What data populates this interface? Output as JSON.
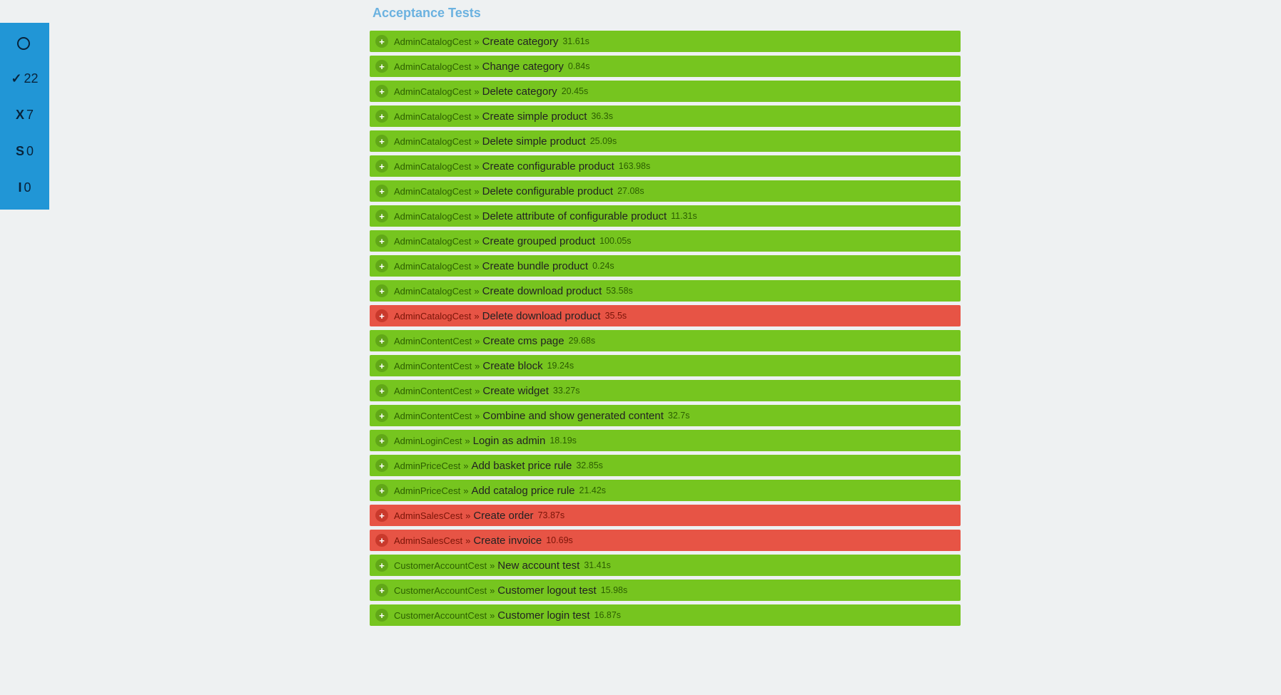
{
  "sidebar": {
    "items": [
      {
        "icon": "circle",
        "count": ""
      },
      {
        "icon": "✓",
        "count": "22"
      },
      {
        "icon": "X",
        "count": "7"
      },
      {
        "icon": "S",
        "count": "0"
      },
      {
        "icon": "I",
        "count": "0"
      }
    ]
  },
  "section_title": "Acceptance Tests",
  "expand_glyph": "+",
  "separator": "»",
  "tests": [
    {
      "class": "AdminCatalogCest",
      "name": "Create category",
      "time": "31.61s",
      "status": "pass"
    },
    {
      "class": "AdminCatalogCest",
      "name": "Change category",
      "time": "0.84s",
      "status": "pass"
    },
    {
      "class": "AdminCatalogCest",
      "name": "Delete category",
      "time": "20.45s",
      "status": "pass"
    },
    {
      "class": "AdminCatalogCest",
      "name": "Create simple product",
      "time": "36.3s",
      "status": "pass"
    },
    {
      "class": "AdminCatalogCest",
      "name": "Delete simple product",
      "time": "25.09s",
      "status": "pass"
    },
    {
      "class": "AdminCatalogCest",
      "name": "Create configurable product",
      "time": "163.98s",
      "status": "pass"
    },
    {
      "class": "AdminCatalogCest",
      "name": "Delete configurable product",
      "time": "27.08s",
      "status": "pass"
    },
    {
      "class": "AdminCatalogCest",
      "name": "Delete attribute of configurable product",
      "time": "11.31s",
      "status": "pass"
    },
    {
      "class": "AdminCatalogCest",
      "name": "Create grouped product",
      "time": "100.05s",
      "status": "pass"
    },
    {
      "class": "AdminCatalogCest",
      "name": "Create bundle product",
      "time": "0.24s",
      "status": "pass"
    },
    {
      "class": "AdminCatalogCest",
      "name": "Create download product",
      "time": "53.58s",
      "status": "pass"
    },
    {
      "class": "AdminCatalogCest",
      "name": "Delete download product",
      "time": "35.5s",
      "status": "fail"
    },
    {
      "class": "AdminContentCest",
      "name": "Create cms page",
      "time": "29.68s",
      "status": "pass"
    },
    {
      "class": "AdminContentCest",
      "name": "Create block",
      "time": "19.24s",
      "status": "pass"
    },
    {
      "class": "AdminContentCest",
      "name": "Create widget",
      "time": "33.27s",
      "status": "pass"
    },
    {
      "class": "AdminContentCest",
      "name": "Combine and show generated content",
      "time": "32.7s",
      "status": "pass"
    },
    {
      "class": "AdminLoginCest",
      "name": "Login as admin",
      "time": "18.19s",
      "status": "pass"
    },
    {
      "class": "AdminPriceCest",
      "name": "Add basket price rule",
      "time": "32.85s",
      "status": "pass"
    },
    {
      "class": "AdminPriceCest",
      "name": "Add catalog price rule",
      "time": "21.42s",
      "status": "pass"
    },
    {
      "class": "AdminSalesCest",
      "name": "Create order",
      "time": "73.87s",
      "status": "fail"
    },
    {
      "class": "AdminSalesCest",
      "name": "Create invoice",
      "time": "10.69s",
      "status": "fail"
    },
    {
      "class": "CustomerAccountCest",
      "name": "New account test",
      "time": "31.41s",
      "status": "pass"
    },
    {
      "class": "CustomerAccountCest",
      "name": "Customer logout test",
      "time": "15.98s",
      "status": "pass"
    },
    {
      "class": "CustomerAccountCest",
      "name": "Customer login test",
      "time": "16.87s",
      "status": "pass"
    }
  ]
}
